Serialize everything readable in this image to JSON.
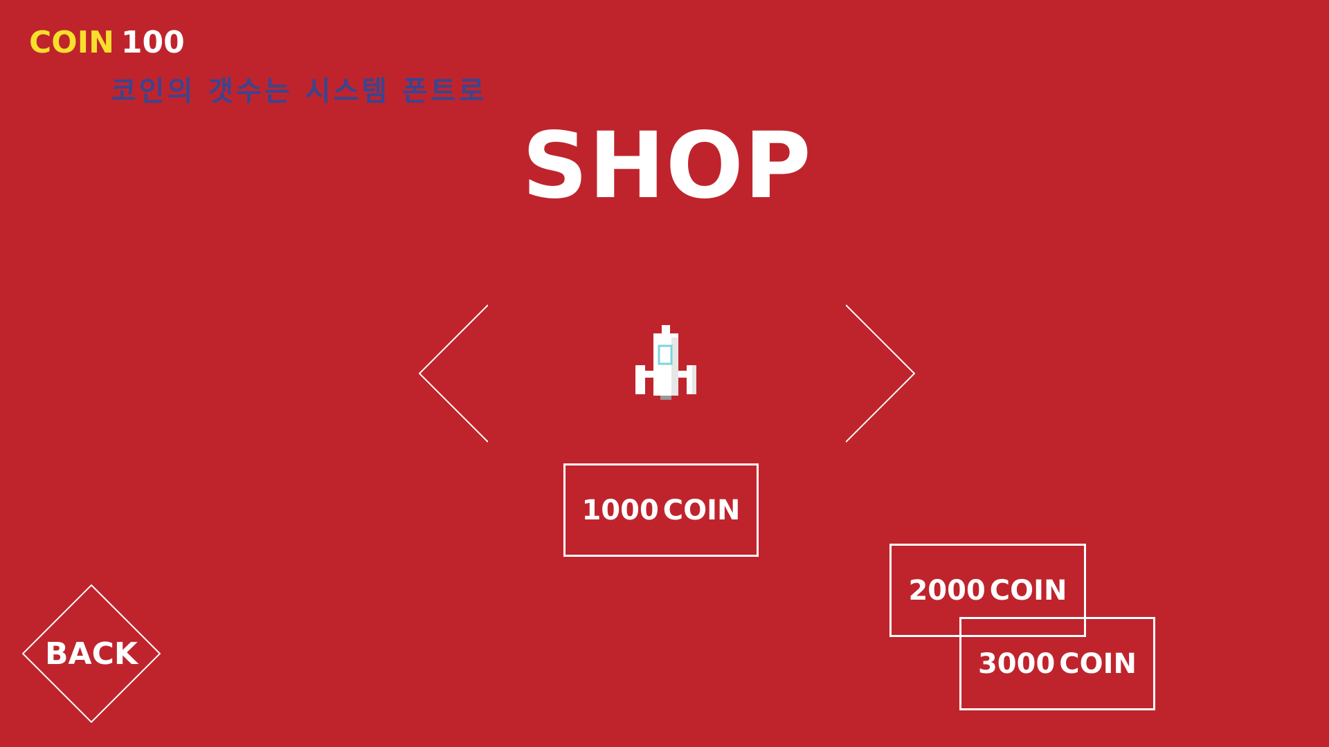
{
  "hud": {
    "coin_label": "COIN",
    "coin_value": "100"
  },
  "note": "코인의 갯수는 시스템 폰트로",
  "title": "SHOP",
  "navigation": {
    "prev_icon": "chevron-left-icon",
    "next_icon": "chevron-right-icon"
  },
  "item": {
    "icon": "spaceship-icon"
  },
  "price_buttons": [
    {
      "amount": "1000",
      "unit": "COIN"
    },
    {
      "amount": "2000",
      "unit": "COIN"
    },
    {
      "amount": "3000",
      "unit": "COIN"
    }
  ],
  "back": {
    "label": "BACK"
  },
  "colors": {
    "background": "#bf242d",
    "coin_label": "#f7e02c",
    "note_text": "#3a4590",
    "foreground": "#ffffff",
    "ship_window": "#7fd3dc"
  }
}
